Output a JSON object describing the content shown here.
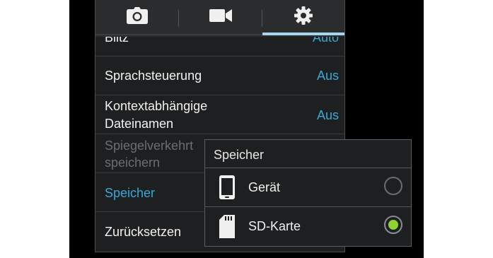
{
  "tabs": [
    {
      "icon": "camera-icon",
      "active": false
    },
    {
      "icon": "video-camera-icon",
      "active": false
    },
    {
      "icon": "gear-icon",
      "active": true
    }
  ],
  "settings": {
    "rows": [
      {
        "label": "Blitz",
        "value": "Auto"
      },
      {
        "label": "Sprachsteuerung",
        "value": "Aus"
      },
      {
        "label_line1": "Kontextabhängige",
        "label_line2": "Dateinamen",
        "value": "Aus"
      },
      {
        "label_line1": "Spiegelverkehrt",
        "label_line2": "speichern",
        "state": "disabled"
      },
      {
        "label": "Speicher",
        "state": "highlighted"
      },
      {
        "label": "Zurücksetzen"
      }
    ]
  },
  "dialog": {
    "title": "Speicher",
    "options": [
      {
        "icon": "phone-device-icon",
        "label": "Gerät",
        "selected": false
      },
      {
        "icon": "sd-card-icon",
        "label": "SD-Karte",
        "selected": true
      }
    ]
  },
  "colors": {
    "accent": "#3aa8d8",
    "tab_indicator": "#aad4ee",
    "radio_selected": "#8ed32f",
    "panel_bg": "#1e1f20"
  }
}
